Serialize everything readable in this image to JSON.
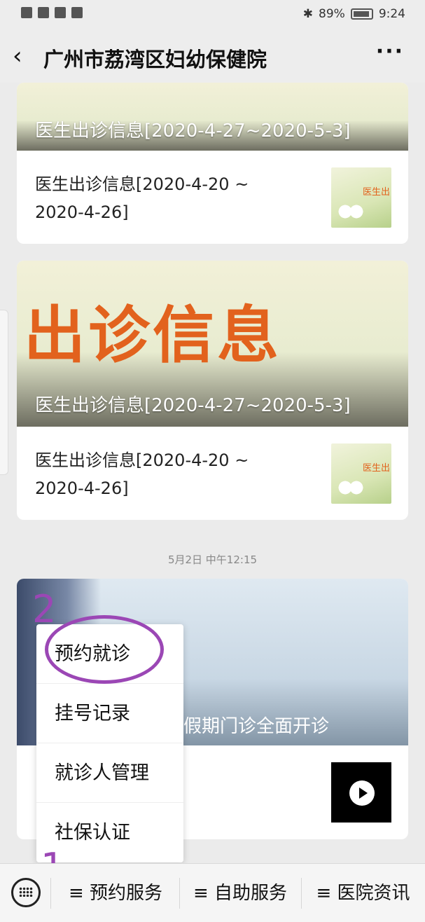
{
  "status_bar": {
    "battery_percent": "89%",
    "time": "9:24"
  },
  "header": {
    "back_glyph": "‹",
    "title": "广州市荔湾区妇幼保健院",
    "more_glyph": "···"
  },
  "cards": [
    {
      "banner_caption": "医生出诊信息[2020-4-27~2020-5-3]",
      "sub_text": "医生出诊信息[2020-4-20 ~ 2020-4-26]",
      "thumb_label": "医生出"
    },
    {
      "banner_bigtext": "出诊信息",
      "banner_caption": "医生出诊信息[2020-4-27~2020-5-3]",
      "sub_text": "医生出诊信息[2020-4-20 ~ 2020-4-26]",
      "thumb_label": "医生出"
    }
  ],
  "timestamp": "5月2日 中午12:15",
  "card3": {
    "banner_caption": "假期门诊全面开诊"
  },
  "popup_menu": {
    "items": [
      "预约就诊",
      "挂号记录",
      "就诊人管理",
      "社保认证"
    ]
  },
  "annotations": {
    "step1": "1",
    "step2": "2"
  },
  "bottom_menu": {
    "tabs": [
      "≡ 预约服务",
      "≡ 自助服务",
      "≡ 医院资讯"
    ]
  },
  "colors": {
    "annotation": "#9b47b5",
    "accent_orange": "#e2621d"
  }
}
